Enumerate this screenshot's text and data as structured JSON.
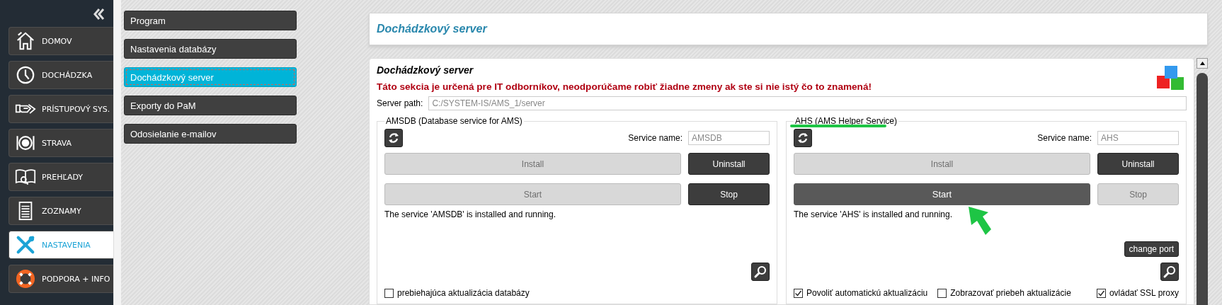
{
  "sidebar": {
    "items": [
      {
        "label": "DOMOV",
        "selected": false
      },
      {
        "label": "DOCHÁDZKA",
        "selected": false
      },
      {
        "label": "PRÍSTUPOVÝ SYS.",
        "selected": false
      },
      {
        "label": "STRAVA",
        "selected": false
      },
      {
        "label": "PREHĽADY",
        "selected": false
      },
      {
        "label": "ZOZNAMY",
        "selected": false
      },
      {
        "label": "NASTAVENIA",
        "selected": true
      },
      {
        "label": "PODPORA + INFO",
        "selected": false
      }
    ]
  },
  "submenu": {
    "items": [
      {
        "label": "Program",
        "selected": false
      },
      {
        "label": "Nastavenia databázy",
        "selected": false
      },
      {
        "label": "Dochádzkový server",
        "selected": true
      },
      {
        "label": "Exporty do PaM",
        "selected": false
      },
      {
        "label": "Odosielanie e-mailov",
        "selected": false
      }
    ]
  },
  "header": {
    "title": "Dochádzkový server"
  },
  "panel": {
    "title": "Dochádzkový server",
    "warning": "Táto sekcia je určená pre IT odborníkov, neodporúčame robiť žiadne zmeny ak ste si nie istý čo to znamená!",
    "server_path": {
      "label": "Server path:",
      "value": "C:/SYSTEM-IS/AMS_1/server"
    },
    "services": [
      {
        "legend": "AMSDB (Database service for AMS)",
        "service_name_label": "Service name:",
        "service_name_value": "AMSDB",
        "buttons": [
          {
            "label": "Install",
            "disabled": true,
            "hovered": false
          },
          {
            "label": "Uninstall",
            "disabled": false,
            "hovered": false
          },
          {
            "label": "Start",
            "disabled": true,
            "hovered": false
          },
          {
            "label": "Stop",
            "disabled": false,
            "hovered": false
          }
        ],
        "status": "The service 'AMSDB' is installed and running.",
        "options_left": [
          {
            "label": "prebiehajúca aktualizácia databázy",
            "checked": false
          }
        ]
      },
      {
        "legend": "AHS (AMS Helper Service)",
        "service_name_label": "Service name:",
        "service_name_value": "AHS",
        "buttons": [
          {
            "label": "Install",
            "disabled": true,
            "hovered": false
          },
          {
            "label": "Uninstall",
            "disabled": false,
            "hovered": false
          },
          {
            "label": "Start",
            "disabled": false,
            "hovered": true
          },
          {
            "label": "Stop",
            "disabled": true,
            "hovered": false
          }
        ],
        "status": "The service 'AHS' is installed and running.",
        "change_port": "change port",
        "options_left": [
          {
            "label": "Povoliť automatickú aktualizáciu",
            "checked": true
          },
          {
            "label": "Zobrazovať priebeh aktualizácie",
            "checked": false
          }
        ],
        "options_right": [
          {
            "label": "ovládať SSL proxy",
            "checked": true
          }
        ]
      }
    ]
  }
}
